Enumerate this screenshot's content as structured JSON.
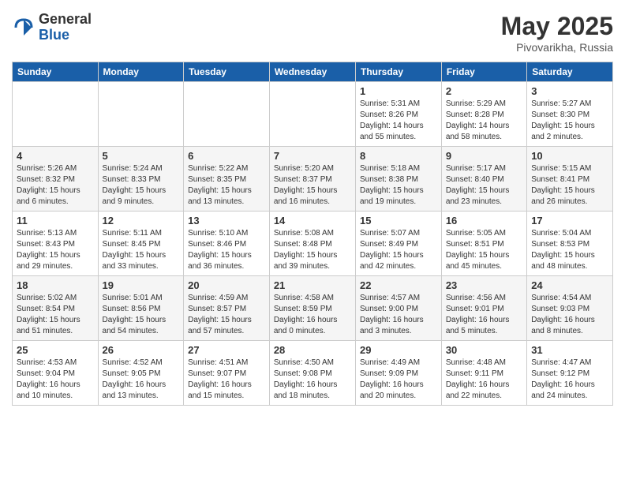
{
  "logo": {
    "general": "General",
    "blue": "Blue"
  },
  "title": {
    "month_year": "May 2025",
    "location": "Pivovarikha, Russia"
  },
  "weekdays": [
    "Sunday",
    "Monday",
    "Tuesday",
    "Wednesday",
    "Thursday",
    "Friday",
    "Saturday"
  ],
  "weeks": [
    [
      {
        "day": "",
        "info": ""
      },
      {
        "day": "",
        "info": ""
      },
      {
        "day": "",
        "info": ""
      },
      {
        "day": "",
        "info": ""
      },
      {
        "day": "1",
        "info": "Sunrise: 5:31 AM\nSunset: 8:26 PM\nDaylight: 14 hours\nand 55 minutes."
      },
      {
        "day": "2",
        "info": "Sunrise: 5:29 AM\nSunset: 8:28 PM\nDaylight: 14 hours\nand 58 minutes."
      },
      {
        "day": "3",
        "info": "Sunrise: 5:27 AM\nSunset: 8:30 PM\nDaylight: 15 hours\nand 2 minutes."
      }
    ],
    [
      {
        "day": "4",
        "info": "Sunrise: 5:26 AM\nSunset: 8:32 PM\nDaylight: 15 hours\nand 6 minutes."
      },
      {
        "day": "5",
        "info": "Sunrise: 5:24 AM\nSunset: 8:33 PM\nDaylight: 15 hours\nand 9 minutes."
      },
      {
        "day": "6",
        "info": "Sunrise: 5:22 AM\nSunset: 8:35 PM\nDaylight: 15 hours\nand 13 minutes."
      },
      {
        "day": "7",
        "info": "Sunrise: 5:20 AM\nSunset: 8:37 PM\nDaylight: 15 hours\nand 16 minutes."
      },
      {
        "day": "8",
        "info": "Sunrise: 5:18 AM\nSunset: 8:38 PM\nDaylight: 15 hours\nand 19 minutes."
      },
      {
        "day": "9",
        "info": "Sunrise: 5:17 AM\nSunset: 8:40 PM\nDaylight: 15 hours\nand 23 minutes."
      },
      {
        "day": "10",
        "info": "Sunrise: 5:15 AM\nSunset: 8:41 PM\nDaylight: 15 hours\nand 26 minutes."
      }
    ],
    [
      {
        "day": "11",
        "info": "Sunrise: 5:13 AM\nSunset: 8:43 PM\nDaylight: 15 hours\nand 29 minutes."
      },
      {
        "day": "12",
        "info": "Sunrise: 5:11 AM\nSunset: 8:45 PM\nDaylight: 15 hours\nand 33 minutes."
      },
      {
        "day": "13",
        "info": "Sunrise: 5:10 AM\nSunset: 8:46 PM\nDaylight: 15 hours\nand 36 minutes."
      },
      {
        "day": "14",
        "info": "Sunrise: 5:08 AM\nSunset: 8:48 PM\nDaylight: 15 hours\nand 39 minutes."
      },
      {
        "day": "15",
        "info": "Sunrise: 5:07 AM\nSunset: 8:49 PM\nDaylight: 15 hours\nand 42 minutes."
      },
      {
        "day": "16",
        "info": "Sunrise: 5:05 AM\nSunset: 8:51 PM\nDaylight: 15 hours\nand 45 minutes."
      },
      {
        "day": "17",
        "info": "Sunrise: 5:04 AM\nSunset: 8:53 PM\nDaylight: 15 hours\nand 48 minutes."
      }
    ],
    [
      {
        "day": "18",
        "info": "Sunrise: 5:02 AM\nSunset: 8:54 PM\nDaylight: 15 hours\nand 51 minutes."
      },
      {
        "day": "19",
        "info": "Sunrise: 5:01 AM\nSunset: 8:56 PM\nDaylight: 15 hours\nand 54 minutes."
      },
      {
        "day": "20",
        "info": "Sunrise: 4:59 AM\nSunset: 8:57 PM\nDaylight: 15 hours\nand 57 minutes."
      },
      {
        "day": "21",
        "info": "Sunrise: 4:58 AM\nSunset: 8:59 PM\nDaylight: 16 hours\nand 0 minutes."
      },
      {
        "day": "22",
        "info": "Sunrise: 4:57 AM\nSunset: 9:00 PM\nDaylight: 16 hours\nand 3 minutes."
      },
      {
        "day": "23",
        "info": "Sunrise: 4:56 AM\nSunset: 9:01 PM\nDaylight: 16 hours\nand 5 minutes."
      },
      {
        "day": "24",
        "info": "Sunrise: 4:54 AM\nSunset: 9:03 PM\nDaylight: 16 hours\nand 8 minutes."
      }
    ],
    [
      {
        "day": "25",
        "info": "Sunrise: 4:53 AM\nSunset: 9:04 PM\nDaylight: 16 hours\nand 10 minutes."
      },
      {
        "day": "26",
        "info": "Sunrise: 4:52 AM\nSunset: 9:05 PM\nDaylight: 16 hours\nand 13 minutes."
      },
      {
        "day": "27",
        "info": "Sunrise: 4:51 AM\nSunset: 9:07 PM\nDaylight: 16 hours\nand 15 minutes."
      },
      {
        "day": "28",
        "info": "Sunrise: 4:50 AM\nSunset: 9:08 PM\nDaylight: 16 hours\nand 18 minutes."
      },
      {
        "day": "29",
        "info": "Sunrise: 4:49 AM\nSunset: 9:09 PM\nDaylight: 16 hours\nand 20 minutes."
      },
      {
        "day": "30",
        "info": "Sunrise: 4:48 AM\nSunset: 9:11 PM\nDaylight: 16 hours\nand 22 minutes."
      },
      {
        "day": "31",
        "info": "Sunrise: 4:47 AM\nSunset: 9:12 PM\nDaylight: 16 hours\nand 24 minutes."
      }
    ]
  ]
}
